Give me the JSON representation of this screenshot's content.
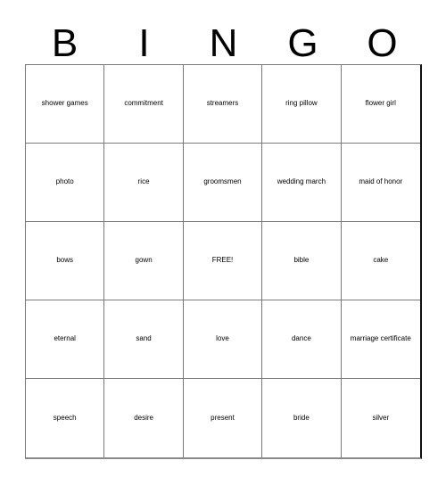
{
  "card": {
    "title": "BINGO",
    "header_letters": [
      "B",
      "I",
      "N",
      "G",
      "O"
    ],
    "free_space_label": "FREE!",
    "colors": {
      "text": "#000000",
      "background": "#ffffff",
      "inner_border": "#7a7a7a",
      "outer_border": "#111111"
    },
    "grid": {
      "columns": 5,
      "rows": 5,
      "cells": [
        {
          "text": "shower games"
        },
        {
          "text": "commitment"
        },
        {
          "text": "streamers"
        },
        {
          "text": "ring pillow"
        },
        {
          "text": "flower girl"
        },
        {
          "text": "photo"
        },
        {
          "text": "rice"
        },
        {
          "text": "groomsmen"
        },
        {
          "text": "wedding march"
        },
        {
          "text": "maid of honor"
        },
        {
          "text": "bows"
        },
        {
          "text": "gown"
        },
        {
          "text": "FREE!"
        },
        {
          "text": "bible"
        },
        {
          "text": "cake"
        },
        {
          "text": "eternal"
        },
        {
          "text": "sand"
        },
        {
          "text": "love"
        },
        {
          "text": "dance"
        },
        {
          "text": "marriage certificate"
        },
        {
          "text": "speech"
        },
        {
          "text": "desire"
        },
        {
          "text": "present"
        },
        {
          "text": "bride"
        },
        {
          "text": "silver"
        }
      ]
    }
  }
}
